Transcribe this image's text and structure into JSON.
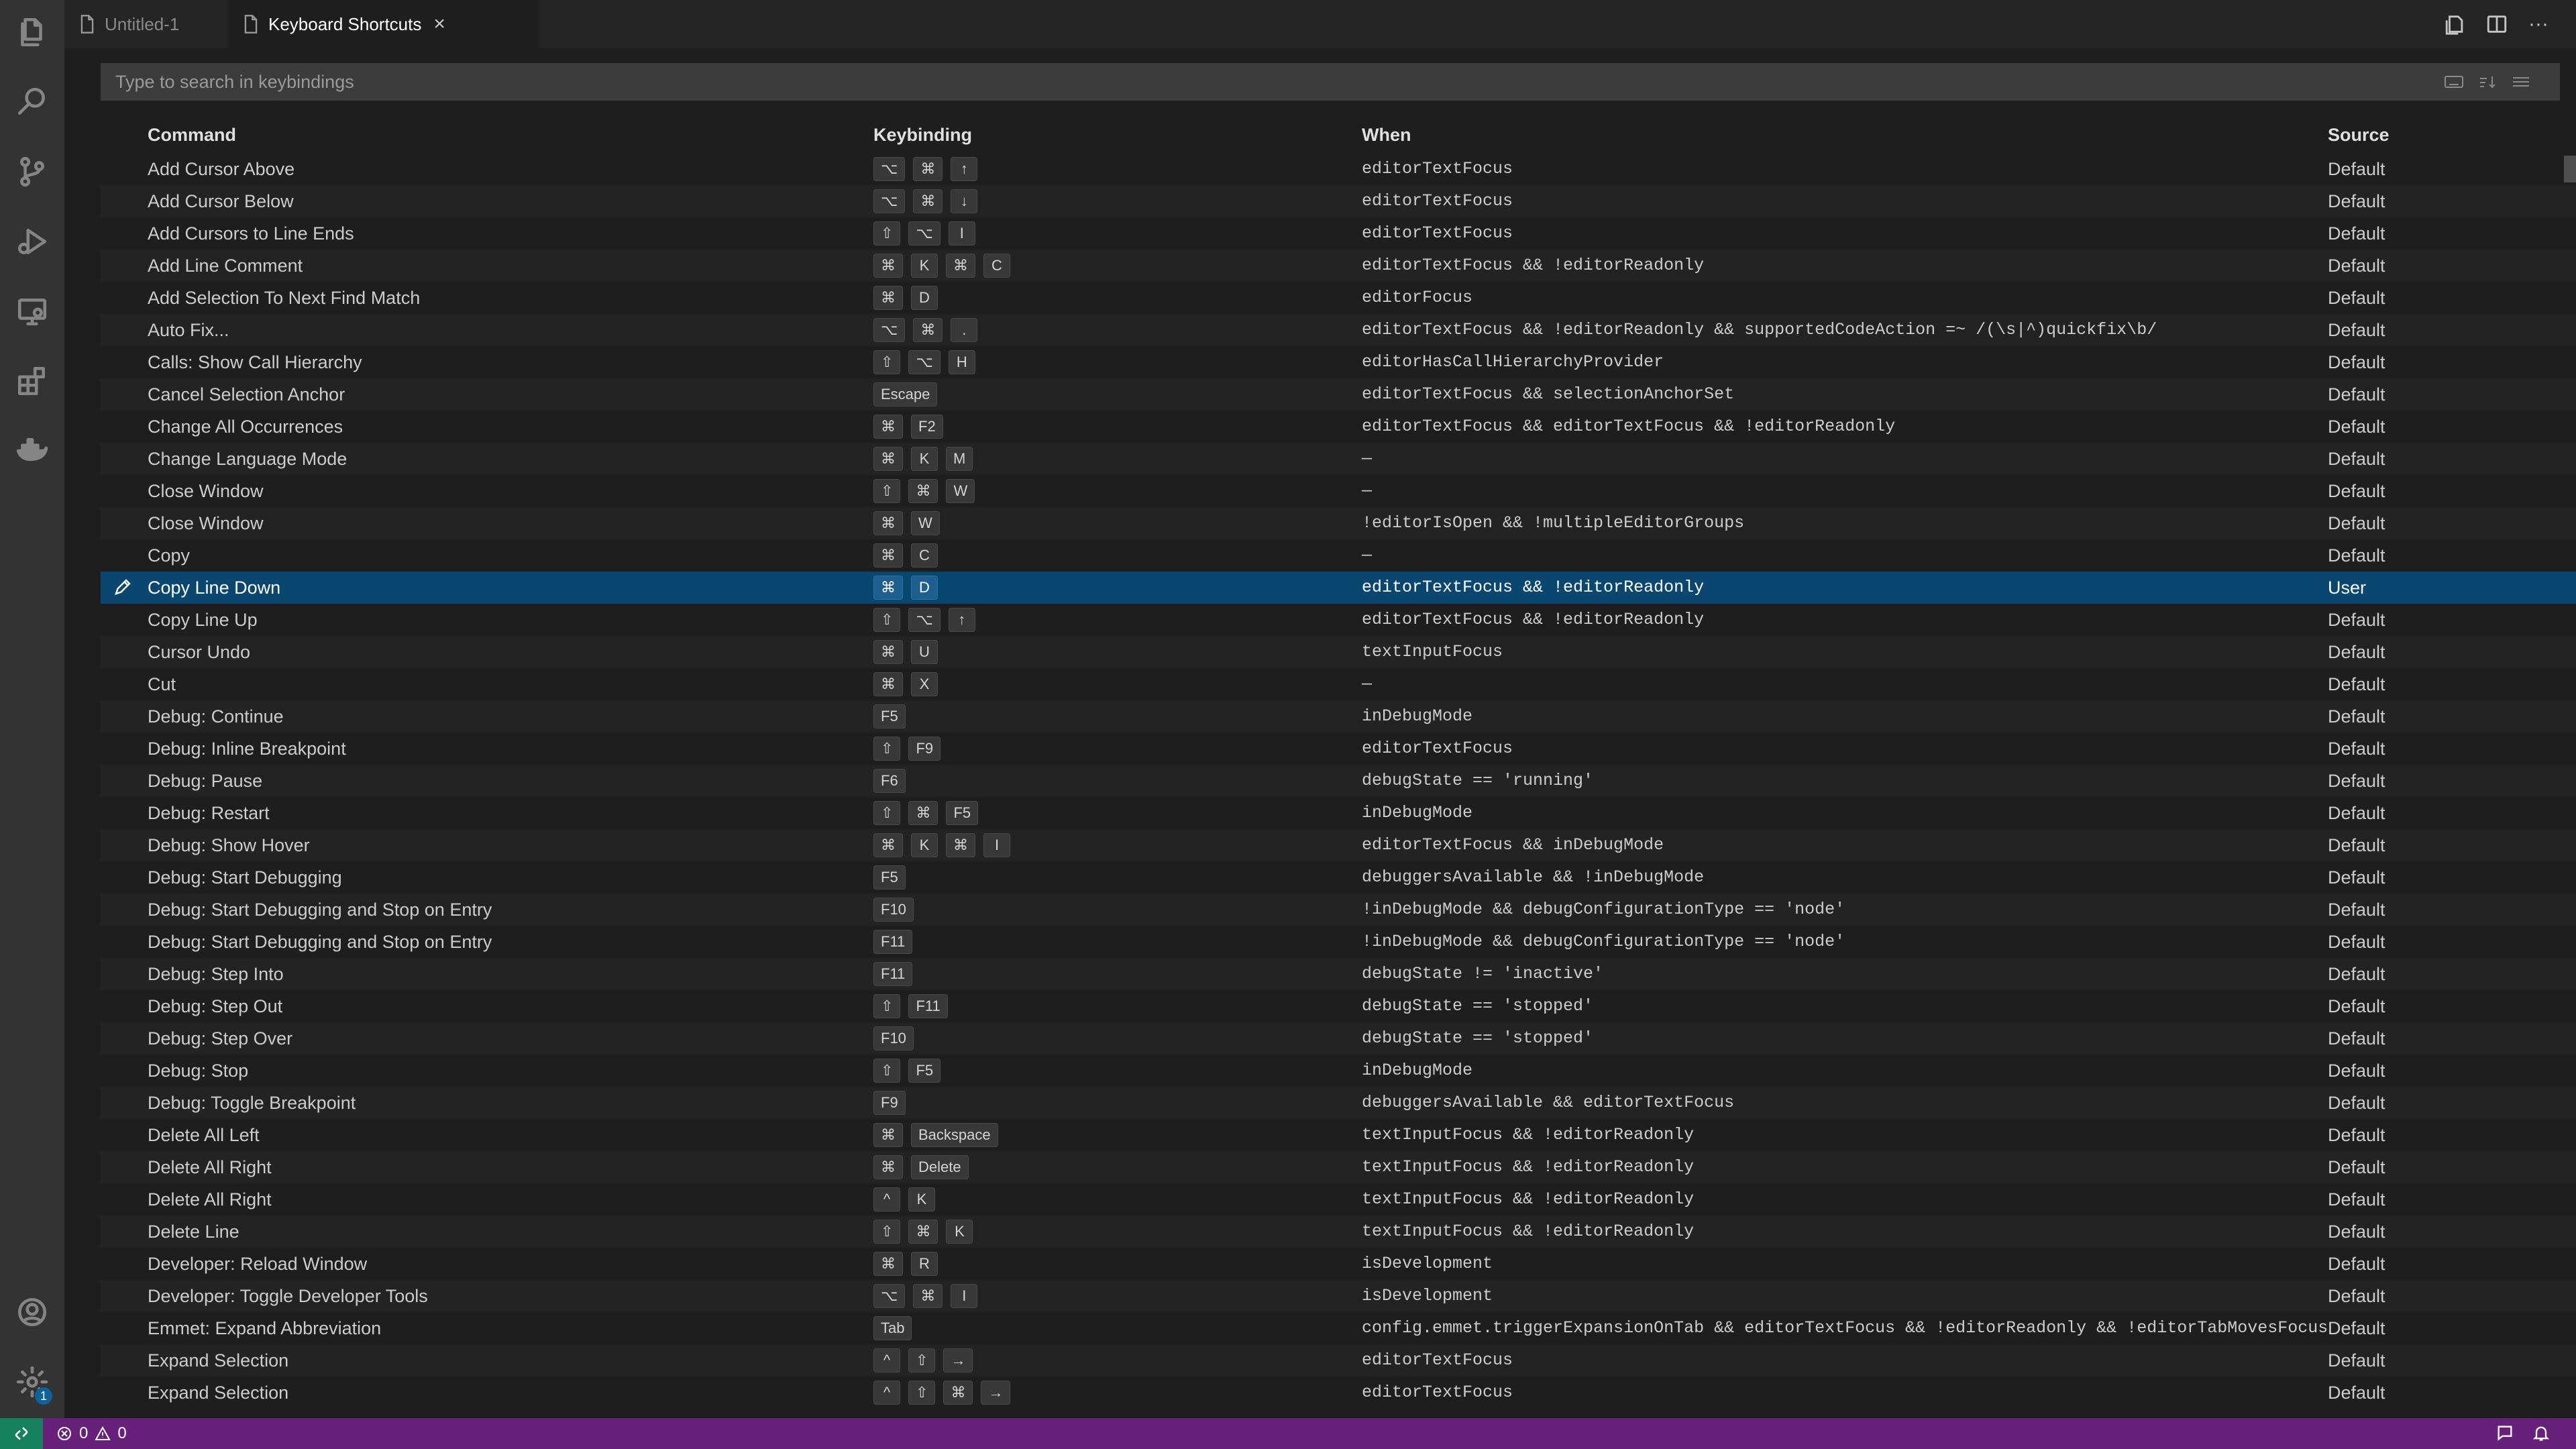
{
  "tabs": [
    {
      "label": "Untitled-1",
      "active": false
    },
    {
      "label": "Keyboard Shortcuts",
      "active": true
    }
  ],
  "search": {
    "placeholder": "Type to search in keybindings",
    "value": ""
  },
  "table": {
    "columns": [
      "Command",
      "Keybinding",
      "When",
      "Source"
    ],
    "rows": [
      {
        "command": "Add Cursor Above",
        "keys": [
          "⌥",
          "⌘",
          "↑"
        ],
        "when": "editorTextFocus",
        "source": "Default"
      },
      {
        "command": "Add Cursor Below",
        "keys": [
          "⌥",
          "⌘",
          "↓"
        ],
        "when": "editorTextFocus",
        "source": "Default"
      },
      {
        "command": "Add Cursors to Line Ends",
        "keys": [
          "⇧",
          "⌥",
          "I"
        ],
        "when": "editorTextFocus",
        "source": "Default"
      },
      {
        "command": "Add Line Comment",
        "keys": [
          "⌘",
          "K",
          "⌘",
          "C"
        ],
        "when": "editorTextFocus && !editorReadonly",
        "source": "Default"
      },
      {
        "command": "Add Selection To Next Find Match",
        "keys": [
          "⌘",
          "D"
        ],
        "when": "editorFocus",
        "source": "Default"
      },
      {
        "command": "Auto Fix...",
        "keys": [
          "⌥",
          "⌘",
          "."
        ],
        "when": "editorTextFocus && !editorReadonly && supportedCodeAction =~ /(\\s|^)quickfix\\b/",
        "source": "Default"
      },
      {
        "command": "Calls: Show Call Hierarchy",
        "keys": [
          "⇧",
          "⌥",
          "H"
        ],
        "when": "editorHasCallHierarchyProvider",
        "source": "Default"
      },
      {
        "command": "Cancel Selection Anchor",
        "keys": [
          "Escape"
        ],
        "when": "editorTextFocus && selectionAnchorSet",
        "source": "Default"
      },
      {
        "command": "Change All Occurrences",
        "keys": [
          "⌘",
          "F2"
        ],
        "when": "editorTextFocus && editorTextFocus && !editorReadonly",
        "source": "Default"
      },
      {
        "command": "Change Language Mode",
        "keys": [
          "⌘",
          "K",
          "M"
        ],
        "when": "—",
        "source": "Default"
      },
      {
        "command": "Close Window",
        "keys": [
          "⇧",
          "⌘",
          "W"
        ],
        "when": "—",
        "source": "Default"
      },
      {
        "command": "Close Window",
        "keys": [
          "⌘",
          "W"
        ],
        "when": "!editorIsOpen && !multipleEditorGroups",
        "source": "Default"
      },
      {
        "command": "Copy",
        "keys": [
          "⌘",
          "C"
        ],
        "when": "—",
        "source": "Default"
      },
      {
        "command": "Copy Line Down",
        "keys": [
          "⌘",
          "D"
        ],
        "when": "editorTextFocus && !editorReadonly",
        "source": "User",
        "selected": true
      },
      {
        "command": "Copy Line Up",
        "keys": [
          "⇧",
          "⌥",
          "↑"
        ],
        "when": "editorTextFocus && !editorReadonly",
        "source": "Default"
      },
      {
        "command": "Cursor Undo",
        "keys": [
          "⌘",
          "U"
        ],
        "when": "textInputFocus",
        "source": "Default"
      },
      {
        "command": "Cut",
        "keys": [
          "⌘",
          "X"
        ],
        "when": "—",
        "source": "Default"
      },
      {
        "command": "Debug: Continue",
        "keys": [
          "F5"
        ],
        "when": "inDebugMode",
        "source": "Default"
      },
      {
        "command": "Debug: Inline Breakpoint",
        "keys": [
          "⇧",
          "F9"
        ],
        "when": "editorTextFocus",
        "source": "Default"
      },
      {
        "command": "Debug: Pause",
        "keys": [
          "F6"
        ],
        "when": "debugState == 'running'",
        "source": "Default"
      },
      {
        "command": "Debug: Restart",
        "keys": [
          "⇧",
          "⌘",
          "F5"
        ],
        "when": "inDebugMode",
        "source": "Default"
      },
      {
        "command": "Debug: Show Hover",
        "keys": [
          "⌘",
          "K",
          "⌘",
          "I"
        ],
        "when": "editorTextFocus && inDebugMode",
        "source": "Default"
      },
      {
        "command": "Debug: Start Debugging",
        "keys": [
          "F5"
        ],
        "when": "debuggersAvailable && !inDebugMode",
        "source": "Default"
      },
      {
        "command": "Debug: Start Debugging and Stop on Entry",
        "keys": [
          "F10"
        ],
        "when": "!inDebugMode && debugConfigurationType == 'node'",
        "source": "Default"
      },
      {
        "command": "Debug: Start Debugging and Stop on Entry",
        "keys": [
          "F11"
        ],
        "when": "!inDebugMode && debugConfigurationType == 'node'",
        "source": "Default"
      },
      {
        "command": "Debug: Step Into",
        "keys": [
          "F11"
        ],
        "when": "debugState != 'inactive'",
        "source": "Default"
      },
      {
        "command": "Debug: Step Out",
        "keys": [
          "⇧",
          "F11"
        ],
        "when": "debugState == 'stopped'",
        "source": "Default"
      },
      {
        "command": "Debug: Step Over",
        "keys": [
          "F10"
        ],
        "when": "debugState == 'stopped'",
        "source": "Default"
      },
      {
        "command": "Debug: Stop",
        "keys": [
          "⇧",
          "F5"
        ],
        "when": "inDebugMode",
        "source": "Default"
      },
      {
        "command": "Debug: Toggle Breakpoint",
        "keys": [
          "F9"
        ],
        "when": "debuggersAvailable && editorTextFocus",
        "source": "Default"
      },
      {
        "command": "Delete All Left",
        "keys": [
          "⌘",
          "Backspace"
        ],
        "when": "textInputFocus && !editorReadonly",
        "source": "Default"
      },
      {
        "command": "Delete All Right",
        "keys": [
          "⌘",
          "Delete"
        ],
        "when": "textInputFocus && !editorReadonly",
        "source": "Default"
      },
      {
        "command": "Delete All Right",
        "keys": [
          "^",
          "K"
        ],
        "when": "textInputFocus && !editorReadonly",
        "source": "Default"
      },
      {
        "command": "Delete Line",
        "keys": [
          "⇧",
          "⌘",
          "K"
        ],
        "when": "textInputFocus && !editorReadonly",
        "source": "Default"
      },
      {
        "command": "Developer: Reload Window",
        "keys": [
          "⌘",
          "R"
        ],
        "when": "isDevelopment",
        "source": "Default"
      },
      {
        "command": "Developer: Toggle Developer Tools",
        "keys": [
          "⌥",
          "⌘",
          "I"
        ],
        "when": "isDevelopment",
        "source": "Default"
      },
      {
        "command": "Emmet: Expand Abbreviation",
        "keys": [
          "Tab"
        ],
        "when": "config.emmet.triggerExpansionOnTab && editorTextFocus && !editorReadonly && !editorTabMovesFocus",
        "source": "Default"
      },
      {
        "command": "Expand Selection",
        "keys": [
          "^",
          "⇧",
          "→"
        ],
        "when": "editorTextFocus",
        "source": "Default"
      },
      {
        "command": "Expand Selection",
        "keys": [
          "^",
          "⇧",
          "⌘",
          "→"
        ],
        "when": "editorTextFocus",
        "source": "Default"
      }
    ]
  },
  "status": {
    "errors": "0",
    "warnings": "0"
  },
  "activity_badge": "1",
  "icons": {
    "activity": [
      "files-icon",
      "search-icon",
      "source-control-icon",
      "run-debug-icon",
      "remote-explorer-icon",
      "extensions-icon",
      "docker-icon",
      "account-icon",
      "settings-gear-icon"
    ]
  },
  "colors": {
    "selection": "#094771",
    "status_bar": "#68217a",
    "remote_indicator": "#16825d",
    "badge": "#0e639c"
  }
}
